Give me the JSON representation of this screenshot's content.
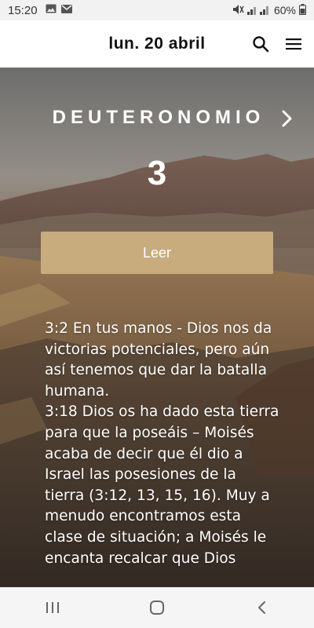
{
  "status_bar": {
    "time": "15:20",
    "battery": "60%",
    "left_icons": [
      "gallery-icon",
      "gmail-icon"
    ],
    "right_icons": [
      "mute-icon",
      "signal-icon",
      "battery-icon"
    ]
  },
  "header": {
    "date": "lun. 20 abril",
    "icons": [
      "search-icon",
      "hamburger-menu-icon"
    ]
  },
  "reading": {
    "book": "DEUTERONOMIO",
    "chapter": "3",
    "read_button": "Leer",
    "commentary": [
      "3:2 En tus manos  -  Dios nos da victorias potenciales, pero aún así tenemos que dar la batalla humana.",
      "3:18 Dios os ha dado esta tierra para que la poseáis – Moisés acaba de decir que él dio a Israel las posesiones de la tierra (3:12, 13, 15, 16). Muy a menudo encontramos esta clase de situación; a Moisés le encanta recalcar que Dios"
    ]
  },
  "nav_bar": {
    "icons": [
      "recent-apps-icon",
      "home-icon",
      "back-icon"
    ]
  },
  "colors": {
    "accent_button": "#c8ac7e",
    "header_bg": "#ffffff",
    "text_on_hero": "#ffffff"
  }
}
